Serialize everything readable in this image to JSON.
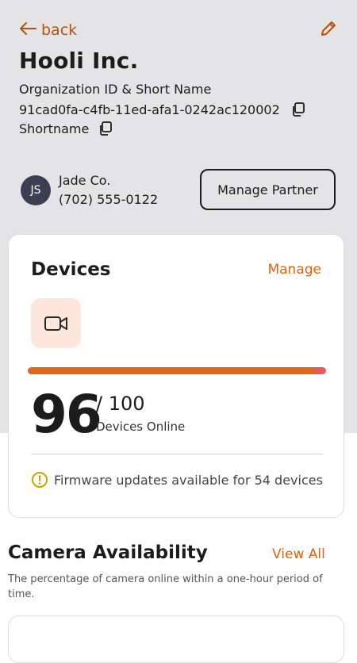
{
  "header": {
    "back_label": "back",
    "org_name": "Hooli Inc.",
    "id_label": "Organization ID & Short Name",
    "org_id": "91cad0fa-c4fb-11ed-afa1-0242ac120002",
    "shortname": "Shortname"
  },
  "partner": {
    "initials": "JS",
    "name": "Jade Co.",
    "phone": "(702) 555-0122",
    "button_label": "Manage Partner"
  },
  "devices": {
    "title": "Devices",
    "manage_label": "Manage",
    "online": "96",
    "total": "/ 100",
    "online_fraction": 0.96,
    "label": "Devices Online",
    "firmware_notice": "Firmware updates available for 54 devices"
  },
  "availability": {
    "title": "Camera Availability",
    "view_all_label": "View All",
    "description": "The percentage of camera online within a one-hour period of time."
  },
  "colors": {
    "accent": "#e0620d",
    "progress_online": "#e06a1c",
    "progress_offline": "#e55b5b",
    "icon_tile_bg": "#fde6dc",
    "header_bg": "#e4e4e6"
  },
  "icons": {
    "back": "arrow-left-icon",
    "edit": "pencil-icon",
    "copy": "copy-icon",
    "camera": "video-camera-icon",
    "warning": "alert-circle-icon"
  }
}
